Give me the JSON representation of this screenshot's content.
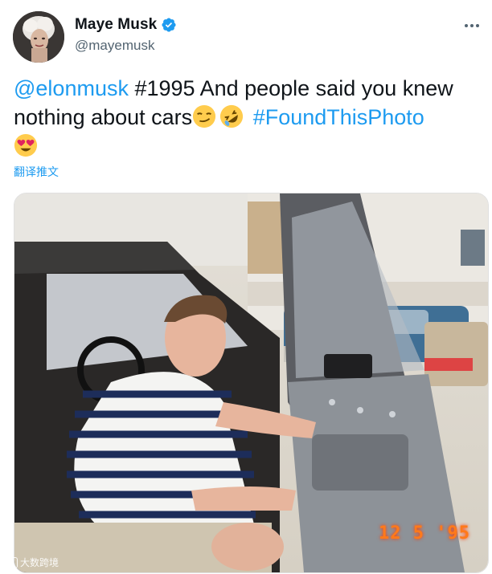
{
  "author": {
    "name": "Maye Musk",
    "handle": "@mayemusk",
    "verified": true
  },
  "tweet": {
    "mention": "@elonmusk",
    "text_1": " #1995 And people said you knew nothing about cars",
    "hashtag": "#FoundThisPhoto",
    "emojis": [
      "smirking-face-icon",
      "rolling-on-floor-laughing-icon",
      "heart-eyes-icon"
    ],
    "translate_label": "翻译推文"
  },
  "photo": {
    "date_stamp": "12  5 '95",
    "watermark": "大数跨境"
  },
  "colors": {
    "link": "#1d9bf0",
    "secondary_text": "#536471",
    "primary_text": "#0f1419",
    "date_stamp": "#ff7a1a"
  }
}
